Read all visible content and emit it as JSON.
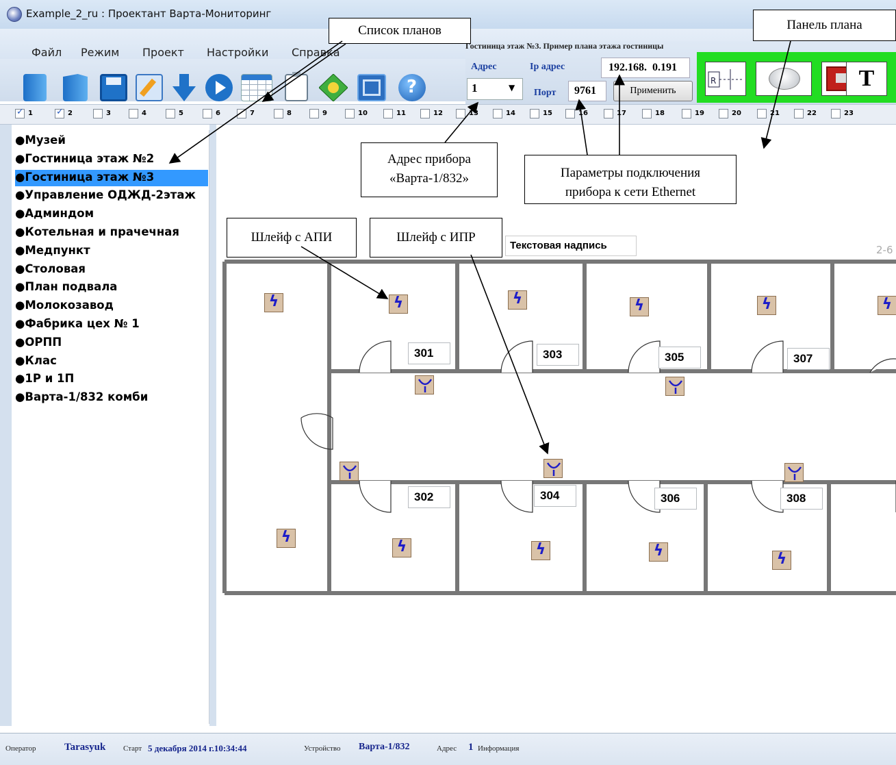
{
  "window": {
    "title": "Example_2_ru : Проектант Варта-Мониторинг"
  },
  "menu": [
    "Файл",
    "Режим",
    "Проект",
    "Настройки",
    "Справка"
  ],
  "plan_header": {
    "title": "Гостиница этаж №3. Пример плана этажа гостиницы",
    "address_label": "Адрес",
    "address_value": "1",
    "ip_label": "Ip адрес",
    "ip_value": "192.168.  0.191",
    "port_label": "Порт",
    "port_value": "9761",
    "apply_label": "Применить"
  },
  "channels": [
    "1",
    "2",
    "3",
    "4",
    "5",
    "6",
    "7",
    "8",
    "9",
    "10",
    "11",
    "12",
    "13",
    "14",
    "15",
    "16",
    "17",
    "18",
    "19",
    "20",
    "21",
    "22",
    "23"
  ],
  "channels_checked": [
    "1",
    "2"
  ],
  "plans": [
    "●Музей",
    "●Гостиница этаж №2",
    "●Гостиница этаж №3",
    "●Управление ОДЖД-2этаж",
    "●Админдом",
    "●Котельная и прачечная",
    "●Медпункт",
    "●Столовая",
    "●План подвала",
    "●Молокозавод",
    "●Фабрика цех № 1",
    "●ОРПП",
    "●Клас",
    "●1Р и 1П",
    "●Варта-1/832 комби"
  ],
  "selected_plan": "●Гостиница этаж №3",
  "callouts": {
    "plan_list": "Список планов",
    "plan_panel": "Панель плана",
    "device_address_1": "Адрес прибора",
    "device_address_2": "«Варта-1/832»",
    "ethernet_1": "Параметры подключения",
    "ethernet_2": "прибора к сети Ethernet",
    "loop_api": "Шлейф с АПИ",
    "loop_ipr": "Шлейф с  ИПР"
  },
  "canvas": {
    "text_label": "Текстовая надпись",
    "corner_label": "2-6",
    "rooms_top": [
      "301",
      "303",
      "305",
      "307"
    ],
    "rooms_bottom": [
      "302",
      "304",
      "306",
      "308"
    ]
  },
  "status": {
    "operator_label": "Оператор",
    "operator_value": "Tarasyuk",
    "start_label": "Старт",
    "start_value": "5 декабря 2014 г.10:34:44",
    "device_label": "Устройство",
    "device_value": "Варта-1/832",
    "address_label": "Адрес",
    "address_value": "1",
    "info_label": "Информация"
  },
  "colors": {
    "plan_panel_bg": "#22dd22",
    "selection": "#3399ff",
    "accent_text": "#15248c"
  }
}
